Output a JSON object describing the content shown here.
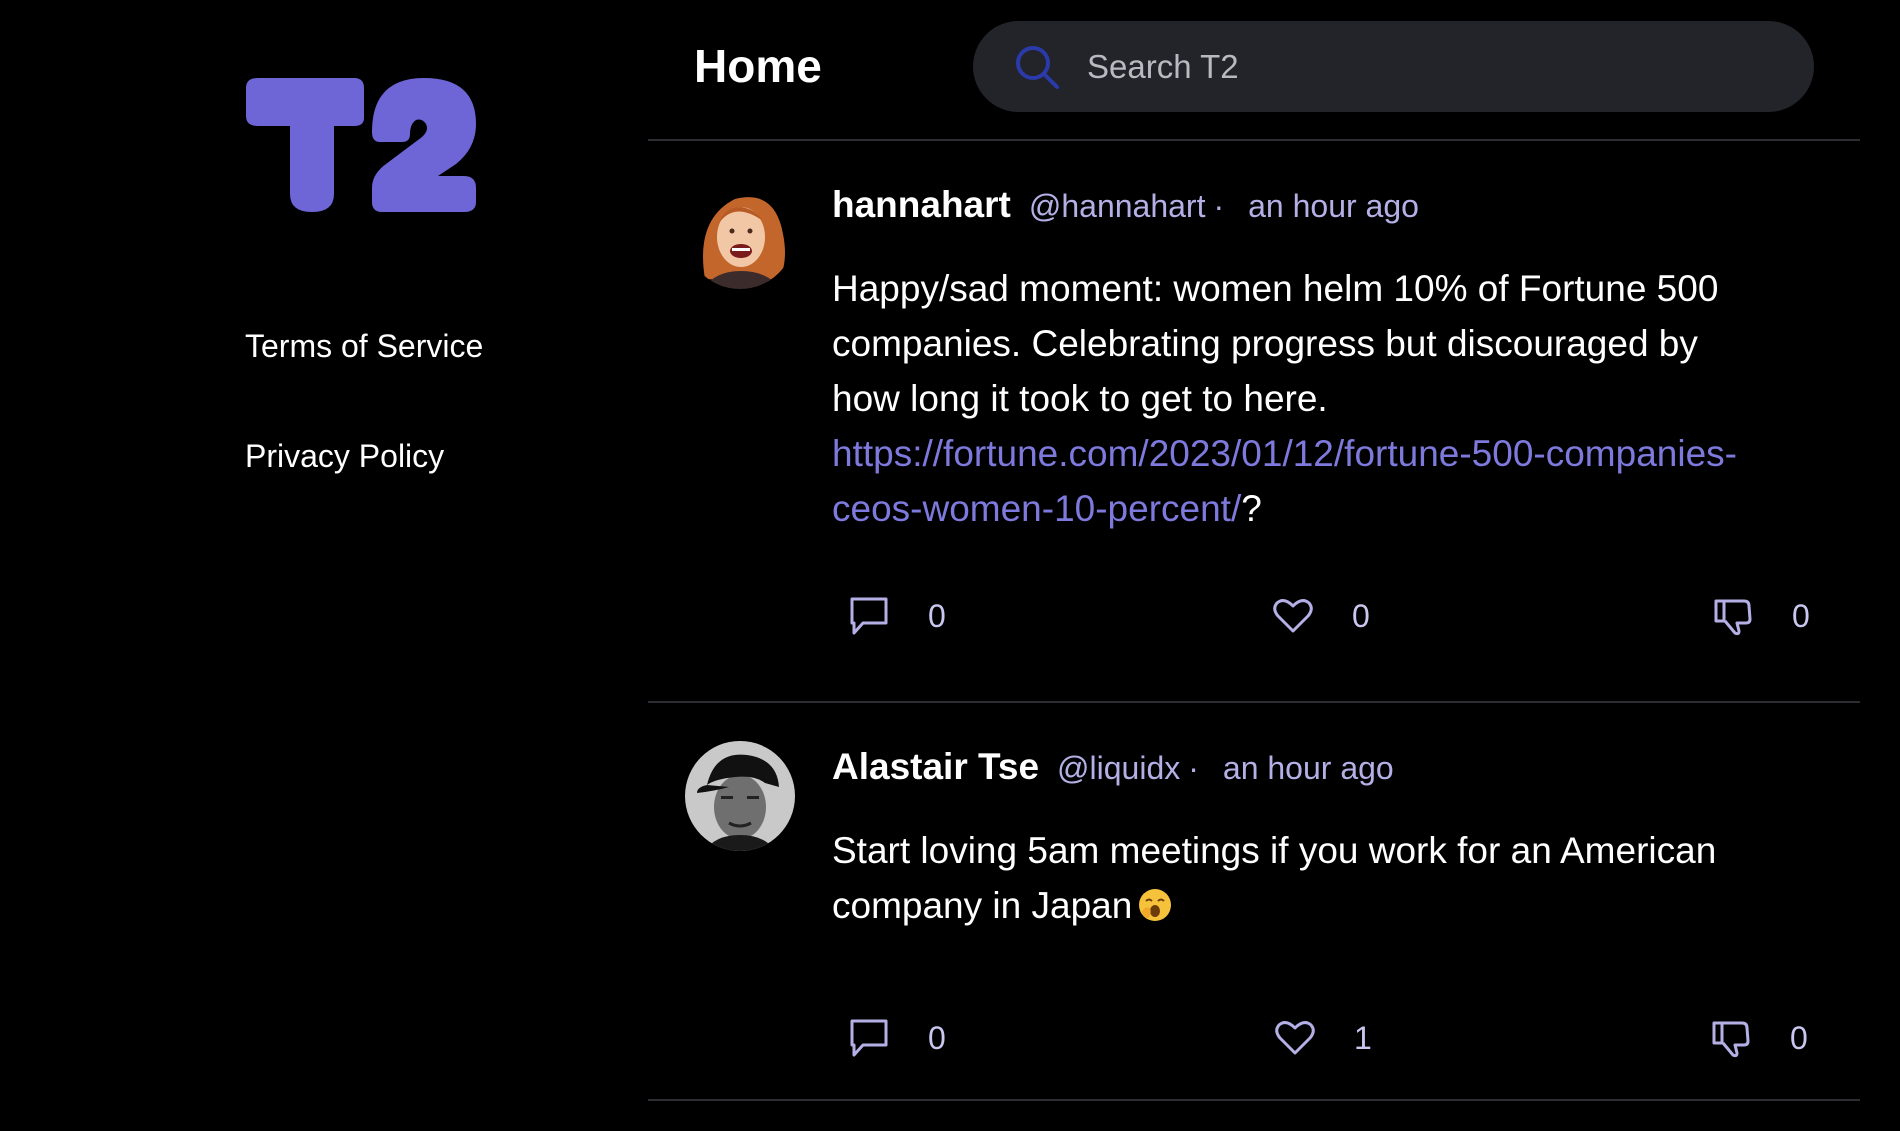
{
  "app": {
    "logo_text": "T2"
  },
  "sidebar": {
    "links": [
      {
        "label": "Terms of Service"
      },
      {
        "label": "Privacy Policy"
      }
    ]
  },
  "header": {
    "title": "Home",
    "search_placeholder": "Search T2",
    "search_icon": "search-icon"
  },
  "colors": {
    "background": "#000000",
    "brand": "#6e66d6",
    "link": "#7e79dc",
    "muted": "#b4b0e6",
    "search_bg": "#23232a",
    "divider": "#2c2c33"
  },
  "posts": [
    {
      "author": "hannahart",
      "handle": "@hannahart",
      "separator": "·",
      "time": "an hour ago",
      "text": "Happy/sad moment: women helm 10% of Fortune 500 companies. Celebrating progress but discouraged by how long it took to get to here.",
      "link": "https://fortune.com/2023/01/12/fortune-500-companies-ceos-women-10-percent/",
      "trailing": "?",
      "replies": "0",
      "likes": "0",
      "dislikes": "0"
    },
    {
      "author": "Alastair Tse",
      "handle": "@liquidx",
      "separator": "·",
      "time": "an hour ago",
      "text": "Start loving 5am meetings if you work for an American company in Japan",
      "emoji": "yawning-face-emoji",
      "replies": "0",
      "likes": "1",
      "dislikes": "0"
    }
  ]
}
